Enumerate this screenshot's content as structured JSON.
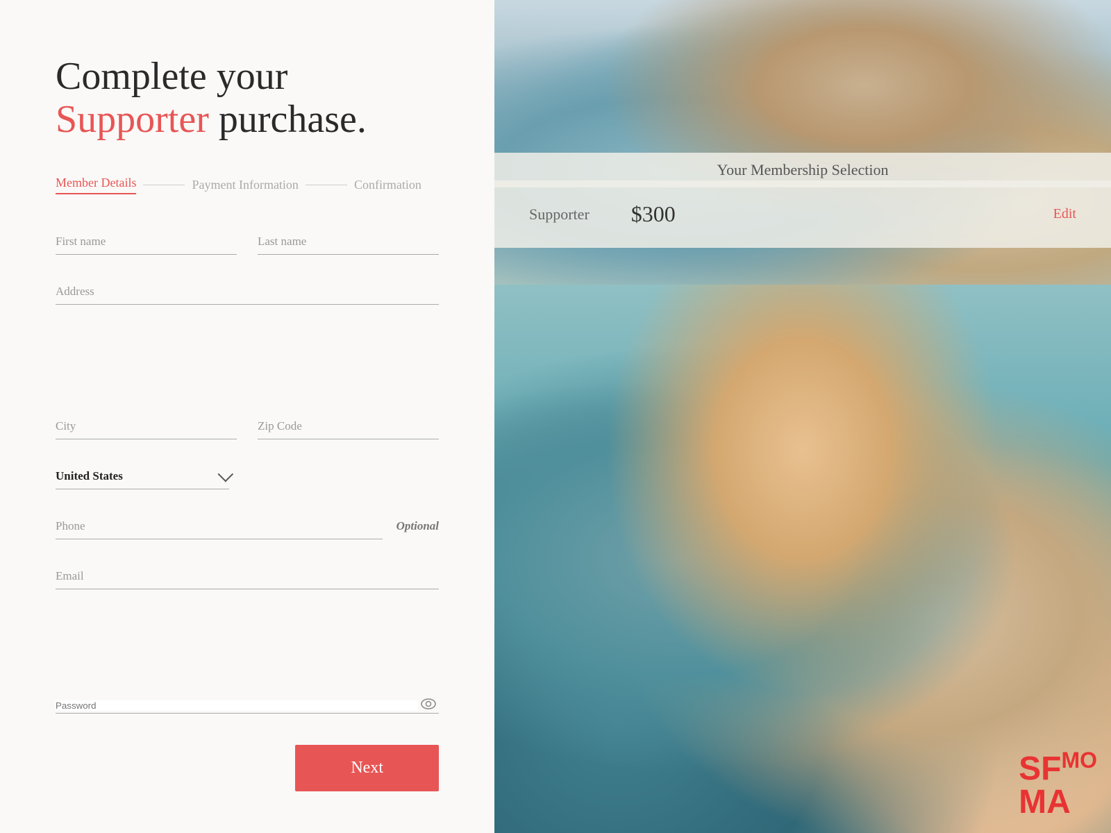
{
  "page": {
    "title_prefix": "Complete your ",
    "title_highlight": "Supporter",
    "title_suffix": " purchase."
  },
  "steps": [
    {
      "id": "member-details",
      "label": "Member Details",
      "active": true
    },
    {
      "id": "payment-information",
      "label": "Payment Information",
      "active": false
    },
    {
      "id": "confirmation",
      "label": "Confirmation",
      "active": false
    }
  ],
  "form": {
    "first_name_placeholder": "First name",
    "last_name_placeholder": "Last name",
    "address_placeholder": "Address",
    "city_placeholder": "City",
    "zip_placeholder": "Zip Code",
    "country_value": "United States",
    "phone_placeholder": "Phone",
    "phone_optional_label": "Optional",
    "email_placeholder": "Email",
    "password_placeholder": "Password"
  },
  "membership": {
    "section_title": "Your Membership Selection",
    "name": "Supporter",
    "price": "$300",
    "edit_label": "Edit"
  },
  "buttons": {
    "next_label": "Next"
  },
  "logo": {
    "sf": "SF",
    "mo": "MO",
    "ma": "MA"
  }
}
